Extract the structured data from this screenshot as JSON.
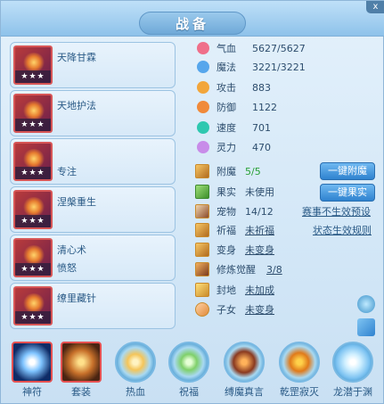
{
  "title": "战备",
  "items": [
    {
      "line1": "天降甘霖",
      "line2": "",
      "stars": "★★★"
    },
    {
      "line1": "天地护法",
      "line2": "",
      "stars": "★★★"
    },
    {
      "line1": "",
      "line2": "专注",
      "stars": "★★★"
    },
    {
      "line1": "涅槃重生",
      "line2": "",
      "stars": "★★★"
    },
    {
      "line1": "清心术",
      "line2": "愤怒",
      "stars": "★★★"
    },
    {
      "line1": "缭里藏针",
      "line2": "",
      "stars": "★★★"
    }
  ],
  "stats": [
    {
      "label": "气血",
      "value": "5627/5627",
      "color": "#ef6f8a"
    },
    {
      "label": "魔法",
      "value": "3221/3221",
      "color": "#56a6ec"
    },
    {
      "label": "攻击",
      "value": "883",
      "color": "#f2a63b"
    },
    {
      "label": "防御",
      "value": "1122",
      "color": "#f08a3a"
    },
    {
      "label": "速度",
      "value": "701",
      "color": "#2fc8b0"
    },
    {
      "label": "灵力",
      "value": "470",
      "color": "#c88ce9"
    }
  ],
  "details": [
    {
      "label": "附魔",
      "value": "5/5"
    },
    {
      "label": "果实",
      "value": "未使用"
    },
    {
      "label": "宠物",
      "value": "14/12"
    },
    {
      "label": "祈福",
      "value": "未祈福"
    },
    {
      "label": "变身",
      "value": "未变身"
    },
    {
      "label": "修炼觉醒",
      "value": "3/8"
    },
    {
      "label": "封地",
      "value": "未加成"
    },
    {
      "label": "子女",
      "value": "未变身"
    }
  ],
  "buttons": {
    "enchant": "一键附魔",
    "fruit": "一键果实"
  },
  "links": {
    "preset": "赛事不生效预设",
    "rule": "状态生效规则"
  },
  "bottom": [
    {
      "label": "神符"
    },
    {
      "label": "套装"
    },
    {
      "label": "热血"
    },
    {
      "label": "祝福"
    },
    {
      "label": "缚魔真言"
    },
    {
      "label": "乾罡寂灭"
    },
    {
      "label": "龙潜于渊"
    }
  ],
  "close": "x"
}
